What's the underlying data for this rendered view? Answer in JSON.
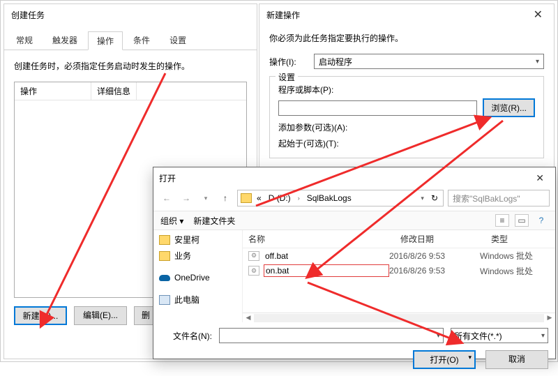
{
  "createTask": {
    "title": "创建任务",
    "tabs": {
      "general": "常规",
      "triggers": "触发器",
      "actions": "操作",
      "conditions": "条件",
      "settings": "设置"
    },
    "instruction": "创建任务时，必须指定任务启动时发生的操作。",
    "cols": {
      "action": "操作",
      "details": "详细信息"
    },
    "buttons": {
      "new": "新建(N)...",
      "edit": "编辑(E)...",
      "delete": "删"
    }
  },
  "newAction": {
    "title": "新建操作",
    "instruction": "你必须为此任务指定要执行的操作。",
    "actionLabel": "操作(I):",
    "actionValue": "启动程序",
    "settingsLegend": "设置",
    "programLabel": "程序或脚本(P):",
    "browse": "浏览(R)...",
    "argsLabel": "添加参数(可选)(A):",
    "startInLabel": "起始于(可选)(T):"
  },
  "openDialog": {
    "title": "打开",
    "path": {
      "drive": "D (D:)",
      "folder": "SqlBakLogs"
    },
    "searchPlaceholder": "搜索\"SqlBakLogs\"",
    "toolbar": {
      "organize": "组织 ▾",
      "newFolder": "新建文件夹"
    },
    "side": {
      "item1": "安里柯",
      "item2": "业务",
      "item3": "OneDrive",
      "item4": "此电脑"
    },
    "cols": {
      "name": "名称",
      "date": "修改日期",
      "type": "类型"
    },
    "files": [
      {
        "name": "off.bat",
        "date": "2016/8/26 9:53",
        "type": "Windows 批处"
      },
      {
        "name": "on.bat",
        "date": "2016/8/26 9:53",
        "type": "Windows 批处"
      }
    ],
    "fileNameLabel": "文件名(N):",
    "fileNameValue": "",
    "filter": "所有文件(*.*)",
    "open": "打开(O)",
    "cancel": "取消"
  }
}
